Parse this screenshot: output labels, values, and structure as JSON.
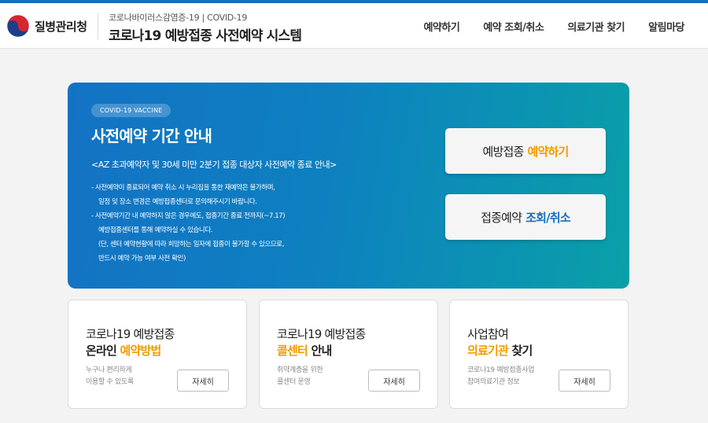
{
  "header": {
    "logo_text": "질병관리청",
    "subtitle": "코로나바이러스감염증-19 | COVID-19",
    "title": "코로나19 예방접종 사전예약 시스템",
    "nav": [
      "예약하기",
      "예약 조회/취소",
      "의료기관 찾기",
      "알림마당"
    ]
  },
  "hero": {
    "badge": "COVID-19 VACCINE",
    "title": "사전예약 기간 안내",
    "subtitle": "<AZ 초과예약자 및 30세 미만 2분기 접종 대상자 사전예약 종료 안내>",
    "notes": [
      "- 사전예약이 종료되어 예약 취소 시 누리집을 통한 재예약은 불가하며,",
      "  일정 및 장소 변경은 예방접종센터로 문의해주시기 바랍니다.",
      "- 사전예약기간 내 예약하지 않은 경우에도, 접종기간 종료 전까지(~7.17)",
      "  예방접종센터를 통해 예약하실 수 있습니다.",
      "  (단, 센터 예약현황에 따라 희망하는 일자에 접종이 불가할 수 있으므로,",
      "  반드시 예약 가능 여부 사전 확인)"
    ],
    "cta_reserve": {
      "prefix": "예방접종",
      "highlight": "예약하기"
    },
    "cta_lookup": {
      "prefix": "접종예약",
      "highlight": "조회/취소"
    }
  },
  "cards": [
    {
      "line1": "코로나19 예방접종",
      "line2_plain": "온라인",
      "line2_orange": "예약방법",
      "line2_tail": "",
      "desc1": "누구나 편리하게",
      "desc2": "이용할 수 있도록",
      "button": "자세히"
    },
    {
      "line1": "코로나19 예방접종",
      "line2_plain": "",
      "line2_orange": "콜센터",
      "line2_tail": "안내",
      "desc1": "취약계층을 위한",
      "desc2": "콜센터 운영",
      "button": "자세히"
    },
    {
      "line1": "사업참여",
      "line2_plain": "",
      "line2_orange": "의료기관",
      "line2_tail": "찾기",
      "desc1": "코로나19 예방접종사업",
      "desc2": "참여의료기관 정보",
      "button": "자세히"
    }
  ],
  "colors": {
    "accent_blue": "#1472c4",
    "accent_teal": "#0aa0a8",
    "highlight_orange": "#f29b00",
    "highlight_blue": "#1b6fbd"
  },
  "icons": {
    "logo": "kdca-taegeuk-logo"
  }
}
